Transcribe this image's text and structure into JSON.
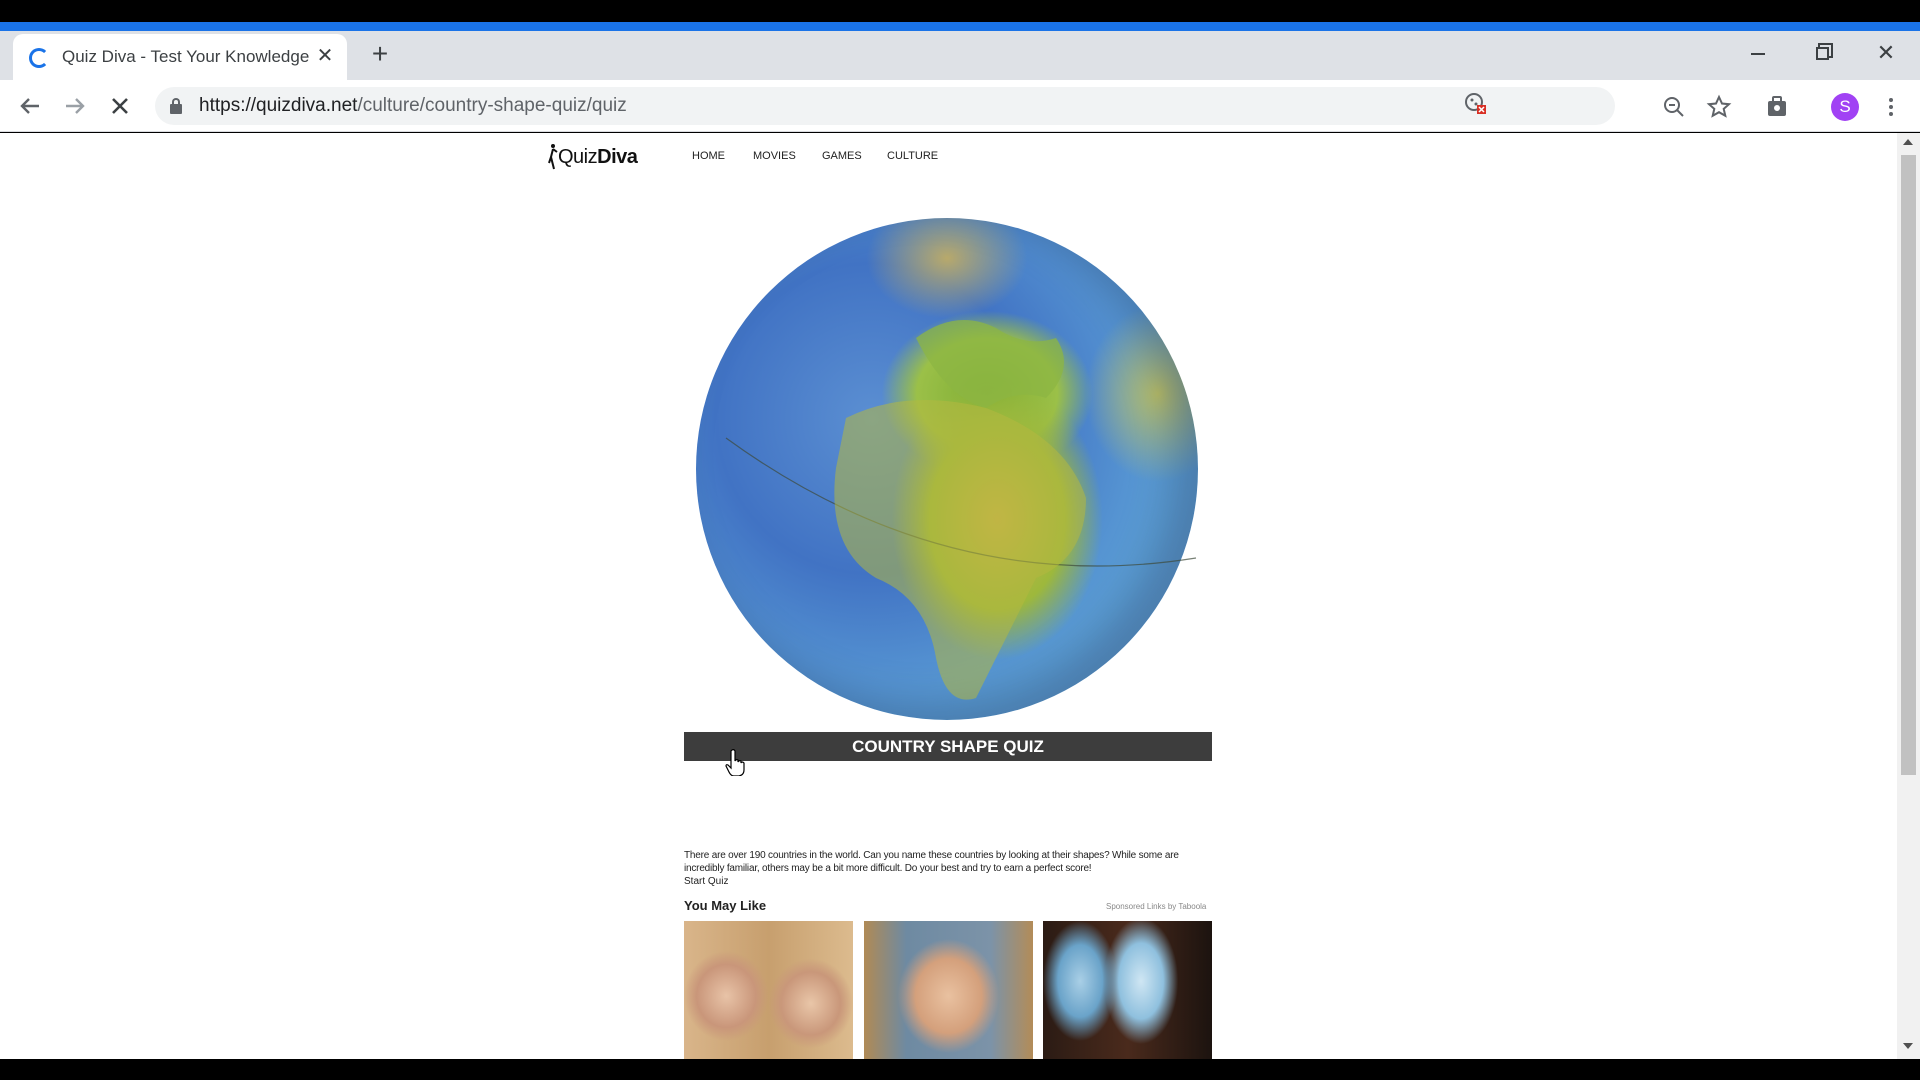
{
  "browser": {
    "tab_title": "Quiz Diva - Test Your Knowledge",
    "tab_close": "✕",
    "new_tab": "+",
    "url_host": "https://quizdiva.net",
    "url_path": "/culture/country-shape-quiz/quiz",
    "profile_initial": "S",
    "accent_color": "#1a73e8"
  },
  "site": {
    "logo_prefix": "Quiz",
    "logo_suffix": "Diva",
    "nav": [
      "HOME",
      "MOVIES",
      "GAMES",
      "CULTURE"
    ]
  },
  "quiz": {
    "title": "COUNTRY SHAPE QUIZ",
    "description": "There are over 190 countries in the world. Can you name these countries by looking at their shapes? While some are incredibly familiar, others may be a bit more difficult. Do your best and try to earn a perfect score!",
    "start_link": "Start Quiz"
  },
  "recommendations": {
    "heading": "You May Like",
    "sponsored": "Sponsored Links by Taboola"
  }
}
